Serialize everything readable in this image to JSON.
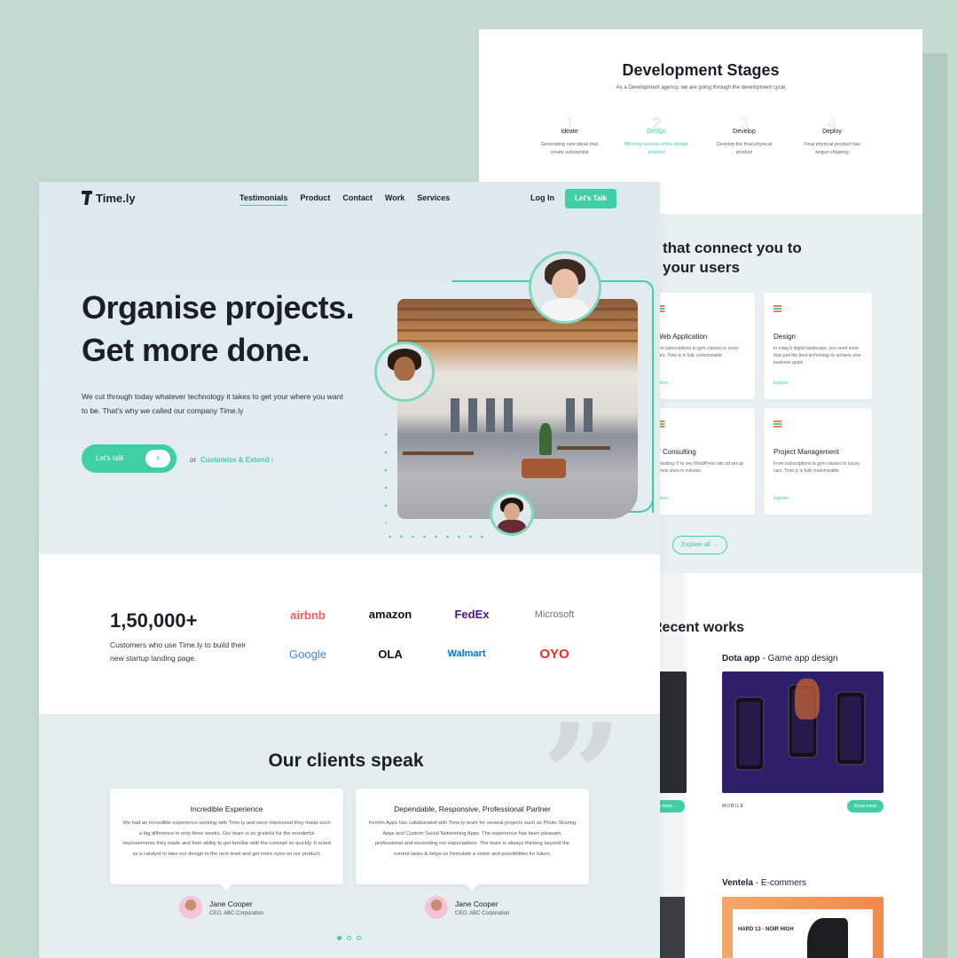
{
  "back": {
    "stages_title": "Development Stages",
    "stages_sub": "As a Development agency, we are going through the development cycle",
    "stages": [
      {
        "num": "1",
        "name": "Ideate",
        "desc": "Generating new ideas that create substantial"
      },
      {
        "num": "2",
        "name": "Design",
        "desc": "Winning version of the design product"
      },
      {
        "num": "3",
        "name": "Develop",
        "desc": "Develop the final physical product"
      },
      {
        "num": "4",
        "name": "Deploy",
        "desc": "Final physical product has begun shipping"
      }
    ],
    "services_heading_1": "that connect you to",
    "services_heading_2": "your users",
    "services": [
      {
        "title": "Web Application",
        "desc": "rom subscriptions to gym classes to uxury cars, Time.ly is fully customizable",
        "explore": "xplore →"
      },
      {
        "title": "Design",
        "desc": "In today's digital landscape, you need more than just the best technology to achieve your business goals",
        "explore": "Explore →"
      },
      {
        "title": "T Consulting",
        "desc": "onsulting IT to any WordPress site nd set up a new store in minutes",
        "explore": "xplore →"
      },
      {
        "title": "Project Management",
        "desc": "From subscriptions to gym classes to luxury cars, Time.ly is fully customizable",
        "explore": "Explore →"
      }
    ],
    "explore_all": "Explore all →",
    "recent_works": "Recent works",
    "work1_name": "Dota app",
    "work1_sub": " - Game app design",
    "work1_meta": "MOBILE",
    "know_more": "Know more",
    "work2_name": "Ventela",
    "work2_sub": " - E-commers",
    "work2_headline": "HARD 13 - NOIR HIGH"
  },
  "front": {
    "logo": "Time.ly",
    "nav": [
      "Testimonials",
      "Product",
      "Contact",
      "Work",
      "Services"
    ],
    "login": "Log In",
    "talk_button": "Let's Talk",
    "hero_line1": "Organise projects.",
    "hero_line2": "Get more done.",
    "hero_desc": "We cut through today whatever technology it takes to get your where you want to be. That's why we called our company Time.ly",
    "cta_label": "Let's talk",
    "cta_arrow": "›",
    "or": "or",
    "customize": "Customize & Extend ›",
    "stat_number": "1,50,000+",
    "stat_caption": "Customers who use Time.ly to build their new startup landing page.",
    "brands": [
      {
        "name": "airbnb",
        "color": "#ff5a5f"
      },
      {
        "name": "amazon",
        "color": "#111111"
      },
      {
        "name": "FedEx",
        "color": "#4d148c"
      },
      {
        "name": "Microsoft",
        "color": "#737373"
      },
      {
        "name": "Google",
        "color": "#4285f4"
      },
      {
        "name": "OLA",
        "color": "#111111"
      },
      {
        "name": "Walmart",
        "color": "#0071ce"
      },
      {
        "name": "OYO",
        "color": "#ee2a24"
      }
    ],
    "clients_title": "Our clients speak",
    "testimonials": [
      {
        "title": "Incredible Experience",
        "body": "We had an incredible experience working with Time.ly and were impressed they made such a big difference in only three weeks. Our team is so grateful for the wonderful improvements they made and their ability to get familiar with the concept so quickly. It acted as a catalyst to take our design to the next level and get more eyes on our product.",
        "name": "Jane Cooper",
        "role": "CEO, ABC Corporation"
      },
      {
        "title": "Dependable, Responsive, Professional Partner",
        "body": "Fermin Apps has collaborated with Time.ly team for several projects such as Photo Sharing Apps and Custom Social Networking Apps. The experience has been pleasant, professional and exceeding our expectations. The team is always thinking beyond the current tasks & helps us formulate a vision and possibilities for future.",
        "name": "Jane Cooper",
        "role": "CEO, ABC Corporation"
      }
    ]
  },
  "colors": {
    "accent": "#3fcfa3",
    "background": "#c5dbd2",
    "dark": "#1c1f24"
  }
}
